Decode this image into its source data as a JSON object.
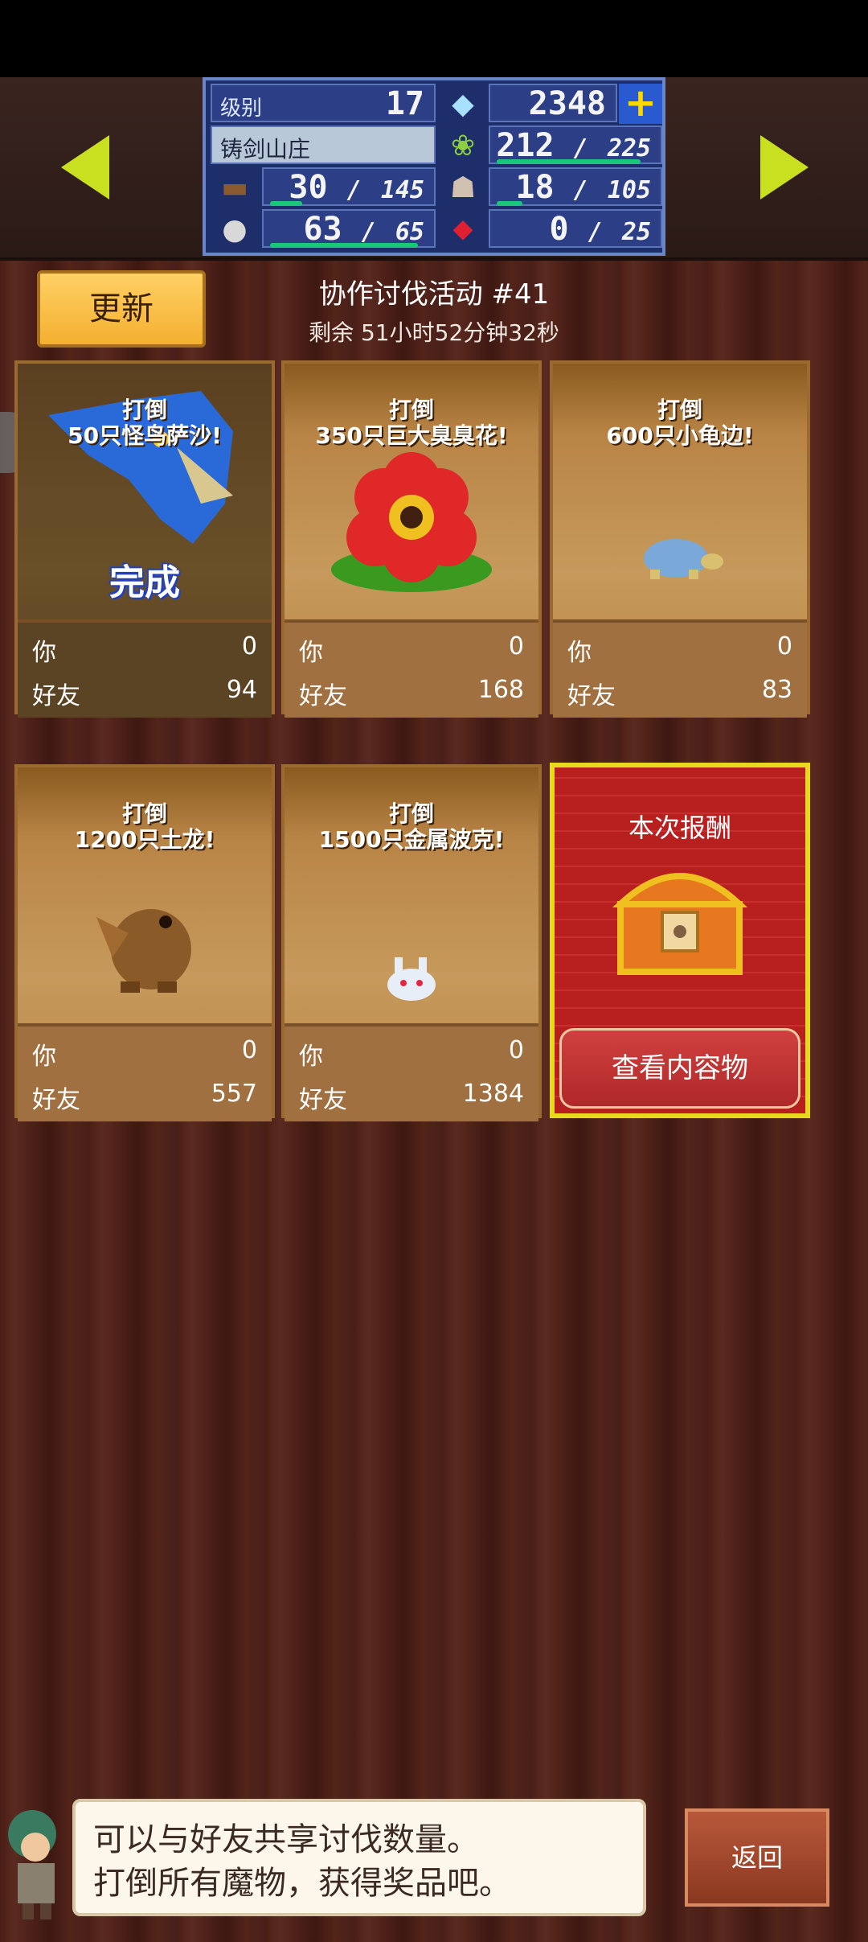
{
  "header": {
    "level_label": "级别",
    "level_value": "17",
    "gems": "2348",
    "town_name": "铸剑山庄",
    "food_current": "212",
    "food_max": "225",
    "food_fill": 0.94,
    "wood_current": "30",
    "wood_max": "145",
    "wood_fill": 0.21,
    "people_current": "18",
    "people_max": "105",
    "people_fill": 0.17,
    "stone_current": "63",
    "stone_max": "65",
    "stone_fill": 0.97,
    "ruby_current": "0",
    "ruby_max": "25",
    "ruby_fill": 0.0,
    "separator": "/"
  },
  "event": {
    "update_label": "更新",
    "title": "协作讨伐活动 #41",
    "time_left": "剩余 51小时52分钟32秒"
  },
  "cards": [
    {
      "line1": "打倒",
      "line2": "50只怪鸟萨沙!",
      "you_label": "你",
      "you": "0",
      "friend_label": "好友",
      "friend": "94",
      "status": "完成"
    },
    {
      "line1": "打倒",
      "line2": "350只巨大臭臭花!",
      "you_label": "你",
      "you": "0",
      "friend_label": "好友",
      "friend": "168"
    },
    {
      "line1": "打倒",
      "line2": "600只小龟边!",
      "you_label": "你",
      "you": "0",
      "friend_label": "好友",
      "friend": "83"
    },
    {
      "line1": "打倒",
      "line2": "1200只土龙!",
      "you_label": "你",
      "you": "0",
      "friend_label": "好友",
      "friend": "557"
    },
    {
      "line1": "打倒",
      "line2": "1500只金属波克!",
      "you_label": "你",
      "you": "0",
      "friend_label": "好友",
      "friend": "1384"
    }
  ],
  "reward": {
    "title": "本次报酬",
    "button": "查看内容物"
  },
  "message": {
    "line1": "可以与好友共享讨伐数量。",
    "line2": "打倒所有魔物，获得奖品吧。"
  },
  "back_label": "返回",
  "colors": {
    "accent_green": "#c8e020",
    "bar": "#18c878",
    "reward_gold": "#e8d820"
  }
}
